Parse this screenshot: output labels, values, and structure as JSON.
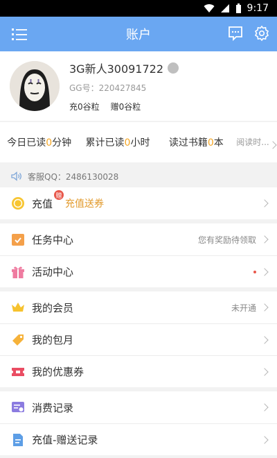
{
  "status_bar": {
    "time": "9:17"
  },
  "header": {
    "title": "账户",
    "menu_icon": "list-icon",
    "message_icon": "message-icon",
    "settings_icon": "gear-icon"
  },
  "profile": {
    "name": "3G新人30091722",
    "gg_id": "GG号：220427845",
    "charged": "充0谷粒",
    "gift": "赠0谷粒"
  },
  "stats": [
    {
      "prefix": "今日已读",
      "value": "0",
      "suffix": "分钟"
    },
    {
      "prefix": "累计已读",
      "value": "0",
      "suffix": "小时"
    },
    {
      "prefix": "读过书籍",
      "value": "0",
      "suffix": "本"
    }
  ],
  "stats_more": "阅读时...",
  "service": "客服QQ：2486130028",
  "menu": {
    "recharge": {
      "label": "充值",
      "badge": "赠",
      "highlight": "充值送券"
    },
    "tasks": {
      "label": "任务中心",
      "right": "您有奖励待领取"
    },
    "activity": {
      "label": "活动中心"
    },
    "vip": {
      "label": "我的会员",
      "right": "未开通"
    },
    "monthly": {
      "label": "我的包月"
    },
    "coupon": {
      "label": "我的优惠券"
    },
    "consume": {
      "label": "消费记录"
    },
    "recharge_log": {
      "label": "充值-赠送记录"
    }
  },
  "colors": {
    "header": "#6aa7f2",
    "accent": "#f5a623",
    "highlight": "#e29a2c",
    "badge": "#e8574a"
  }
}
